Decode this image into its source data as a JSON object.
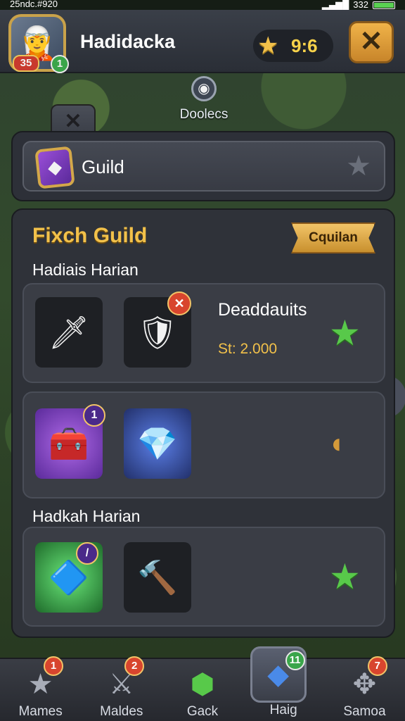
{
  "status_bar": {
    "left": "25ndc.#920",
    "right": "332"
  },
  "header": {
    "player_name": "Hadidacka",
    "level_badge": "35",
    "level_badge2": "1",
    "currency_value": "9:6",
    "close_symbol": "✕"
  },
  "map": {
    "label": "Doolecs"
  },
  "tab_close_symbol": "✕",
  "guild_bar": {
    "label": "Guild"
  },
  "panel": {
    "title": "Fixch Guild",
    "ribbon": "Cquilan",
    "sections": [
      {
        "label": "Hadiais Harian"
      },
      {
        "label": "Hadkah Harian"
      }
    ],
    "cards": [
      {
        "name": "Deaddauits",
        "price": "St: 2.000",
        "badge": "✕"
      },
      {
        "badge": "1"
      },
      {
        "badge": "/"
      }
    ]
  },
  "bottom_nav": {
    "items": [
      {
        "label": "Mames",
        "badge": "1"
      },
      {
        "label": "Maldes",
        "badge": "2"
      },
      {
        "label": "Gack",
        "badge": ""
      },
      {
        "label": "Haig",
        "badge": "11"
      },
      {
        "label": "Samoa",
        "badge": "7"
      }
    ]
  },
  "colors": {
    "accent_gold": "#f2c14a",
    "star_green": "#58c94a",
    "badge_red": "#d8452e",
    "panel_bg": "#2f3239"
  }
}
